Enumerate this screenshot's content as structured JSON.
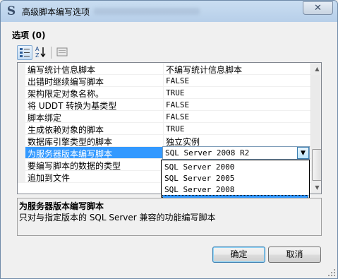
{
  "window": {
    "title": "高级脚本编写选项",
    "close_glyph": "✕"
  },
  "options_label": "选项 (0)",
  "toolbar": {
    "categorized_icon": "categorized-view-icon",
    "alphabetical_icon": "alphabetical-sort-icon",
    "property_pages_icon": "property-pages-icon"
  },
  "properties": [
    {
      "name": "编写统计信息脚本",
      "value": "不编写统计信息脚本"
    },
    {
      "name": "出错时继续编写脚本",
      "value": "FALSE"
    },
    {
      "name": "架构限定对象名称。",
      "value": "TRUE"
    },
    {
      "name": "将 UDDT 转换为基类型",
      "value": "FALSE"
    },
    {
      "name": "脚本绑定",
      "value": "FALSE"
    },
    {
      "name": "生成依赖对象的脚本",
      "value": "TRUE"
    },
    {
      "name": "数据库引擎类型的脚本",
      "value": "独立实例"
    },
    {
      "name": "为服务器版本编写脚本",
      "value": "SQL Server 2008 R2"
    },
    {
      "name": "要编写脚本的数据的类型",
      "value": ""
    },
    {
      "name": "追加到文件",
      "value": ""
    }
  ],
  "combo": {
    "selected": "SQL Server 2008 R2",
    "options": [
      "SQL Server 2000",
      "SQL Server 2005",
      "SQL Server 2008",
      "SQL Server 2008 R2"
    ]
  },
  "description": {
    "title": "为服务器版本编写脚本",
    "text": "只对与指定版本的 SQL Server 兼容的功能编写脚本"
  },
  "buttons": {
    "ok": "确定",
    "cancel": "取消"
  },
  "colors": {
    "selection": "#3399ff",
    "title_gradient": "#c9ddf1"
  }
}
